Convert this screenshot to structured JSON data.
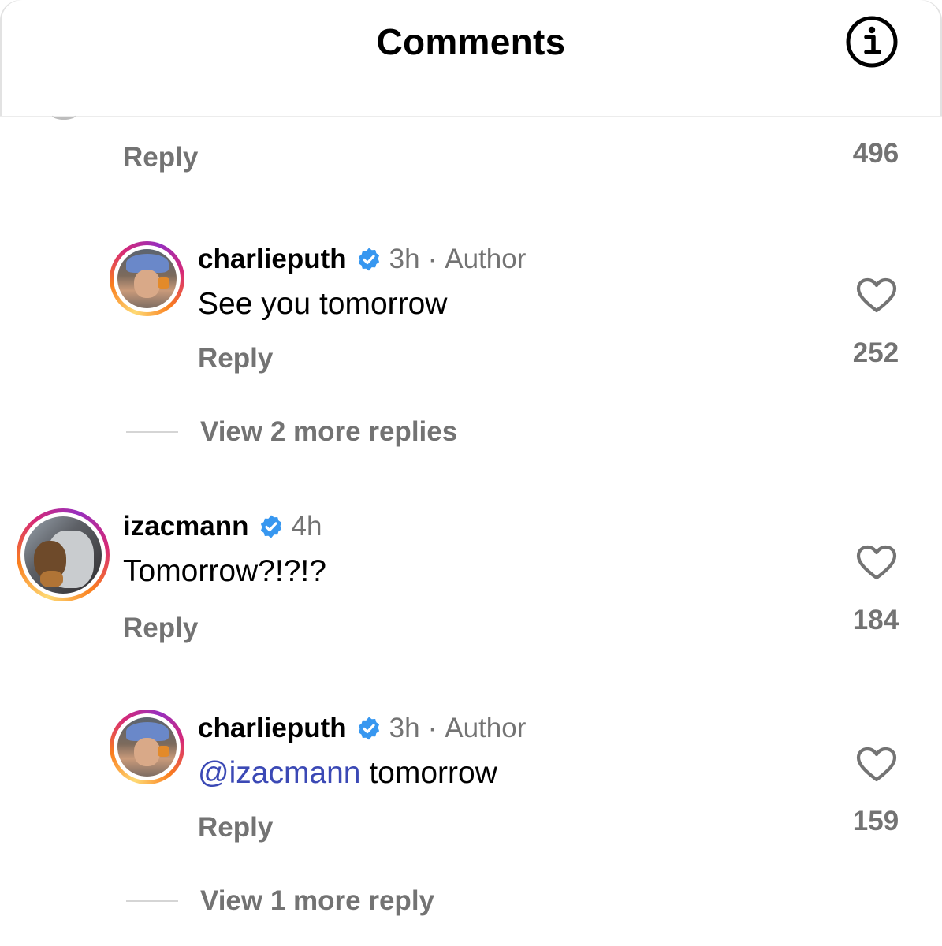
{
  "header": {
    "title": "Comments",
    "info_icon": "info-icon"
  },
  "colors": {
    "secondary_text": "#737373",
    "mention": "#3b49b5",
    "verified_badge": "#3797f0"
  },
  "top_partial": {
    "reply_label": "Reply",
    "like_count": "496"
  },
  "comments": [
    {
      "username": "charlieputh",
      "verified": true,
      "time": "3h",
      "separator": "·",
      "author_label": "Author",
      "text": "See you tomorrow",
      "reply_label": "Reply",
      "like_count": "252",
      "view_more": "View 2 more replies"
    },
    {
      "username": "izacmann",
      "verified": true,
      "time": "4h",
      "text": "Tomorrow?!?!?",
      "reply_label": "Reply",
      "like_count": "184"
    },
    {
      "username": "charlieputh",
      "verified": true,
      "time": "3h",
      "separator": "·",
      "author_label": "Author",
      "mention": "@izacmann",
      "text": " tomorrow",
      "reply_label": "Reply",
      "like_count": "159",
      "view_more": "View 1 more reply"
    }
  ]
}
